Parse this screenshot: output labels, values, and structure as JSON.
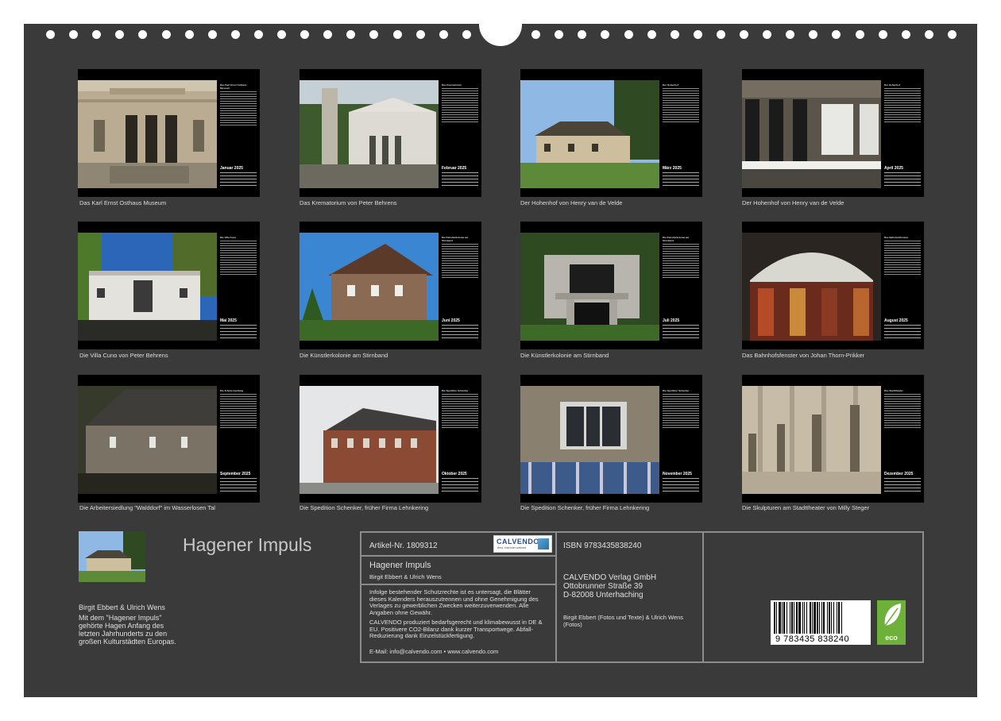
{
  "months": [
    {
      "month": "Januar 2025",
      "title": "Das Karl Ernst Osthaus Museum",
      "caption": "Das Karl Ernst Osthaus Museum"
    },
    {
      "month": "Februar 2025",
      "title": "Das Krematorium",
      "caption": "Das Krematorium von Peter Behrens"
    },
    {
      "month": "März 2025",
      "title": "Der Hohenhof",
      "caption": "Der Hohenhof von Henry van de Velde"
    },
    {
      "month": "April 2025",
      "title": "Der Hohenhof",
      "caption": "Der Hohenhof von Henry van de Velde"
    },
    {
      "month": "Mai 2025",
      "title": "Die Villa Cuno",
      "caption": "Die Villa Cuno von Peter Behrens"
    },
    {
      "month": "Juni 2025",
      "title": "Die Künstlerkolonie am Stirnband",
      "caption": "Die Künstlerkolonie am Stirnband"
    },
    {
      "month": "Juli 2025",
      "title": "Die Künstlerkolonie am Stirnband",
      "caption": "Die Künstlerkolonie am Stirnband"
    },
    {
      "month": "August 2025",
      "title": "Das Bahnhofsfenster",
      "caption": "Das Bahnhofsfenster von Johan Thorn-Prikker"
    },
    {
      "month": "September 2025",
      "title": "Die Arbeitersiedlung",
      "caption": "Die Arbeitersiedlung \"Walddorf\" im Wasserlosen Tal"
    },
    {
      "month": "Oktober 2025",
      "title": "Die Spedition Schenker",
      "caption": "Die Spedition Schenker, früher Firma Lehnkering"
    },
    {
      "month": "November 2025",
      "title": "Die Spedition Schenker",
      "caption": "Die Spedition Schenker, früher Firma Lehnkering"
    },
    {
      "month": "Dezember 2025",
      "title": "Das Stadttheater",
      "caption": "Die Skulpturen am Stadttheater von Milly Steger"
    }
  ],
  "cover": {
    "title": "Hagener Impuls",
    "authors": "Birgit Ebbert & Ulrich Wens",
    "blurb": "Mit dem \"Hagener Impuls\" gehörte Hagen Anfang des letzten Jahrhunderts zu den großen Kulturstädten Europas."
  },
  "info": {
    "article": "Artikel-Nr. 1809312",
    "logo_name": "CALVENDO",
    "logo_tagline": "Best. Kalender weltweit",
    "book_title": "Hagener Impuls",
    "book_authors": "Birgit Ebbert & Ulrich Wens",
    "copyright": "Infolge bestehender Schutzrechte ist es untersagt, die Blätter dieses Kalenders herauszutrennen und ohne Genehmigung des Verlages zu gewerblichen Zwecken weiterzuverwenden. Alle Angaben ohne Gewähr.",
    "eco_note": "CALVENDO produziert bedarfsgerecht und klimabewusst in DE & EU. Positivere CO2-Bilanz dank kurzer Transportwege. Abfall-Reduzierung dank Einzelstückfertigung.",
    "email": "E-Mail: info@calvendo.com • www.calvendo.com",
    "isbn": "ISBN 9783435838240",
    "publisher": "CALVENDO Verlag GmbH",
    "street": "Ottobrunner Straße 39",
    "city": "D-82008 Unterhaching",
    "credits": "Birgit Ebbert (Fotos und Texte) & Ulrich Wens (Fotos)",
    "barcode": "9 783435 838240",
    "eco_label": "eco"
  },
  "colors": {
    "background": "#3a3a3a",
    "card": "#000000",
    "frame": "#8c8c8c",
    "eco_green": "#6db03a"
  }
}
